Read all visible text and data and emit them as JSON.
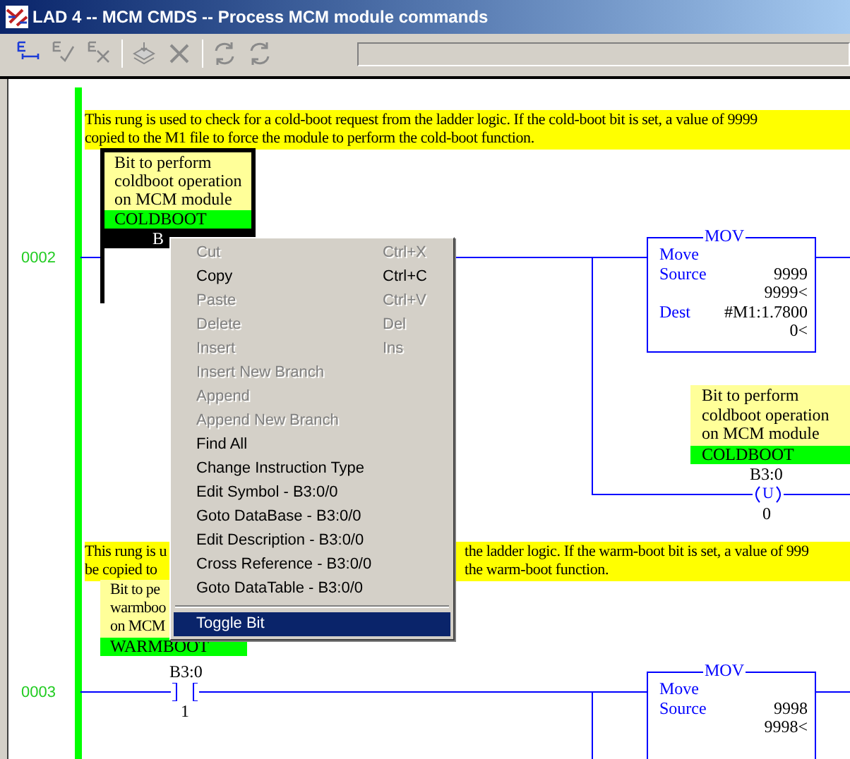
{
  "window": {
    "title": "LAD 4 -- MCM CMDS -- Process MCM module commands"
  },
  "toolbar": {
    "buttons": [
      {
        "kind": "edit",
        "disabled": false
      },
      {
        "kind": "accept",
        "disabled": true
      },
      {
        "kind": "cancel",
        "disabled": true
      },
      {
        "kind": "test",
        "disabled": true
      },
      {
        "kind": "delete",
        "disabled": true
      },
      {
        "kind": "refresh",
        "disabled": true
      },
      {
        "kind": "refresh",
        "disabled": true
      }
    ]
  },
  "rungs": [
    {
      "number": "0002",
      "comment": [
        {
          "segments": [
            "This rung is used to check for a cold-boot request from the ladder logic.  If the cold-boot bit is set, a value of 9999"
          ]
        },
        {
          "segments": [
            "copied to the M1 file to force the module to perform the cold-boot function."
          ]
        }
      ],
      "contact": {
        "description": [
          "Bit to perform",
          "coldboot operation",
          "on MCM module"
        ],
        "symbol": "COLDBOOT",
        "address": "B",
        "selected": true
      },
      "mov": {
        "title": "MOV",
        "name": "Move",
        "source_label": "Source",
        "source": "9999",
        "source_value": "9999<",
        "dest_label": "Dest",
        "dest": "#M1:1.7800",
        "dest_value": "0<"
      },
      "coil": {
        "description": [
          "Bit to perform",
          "coldboot operation",
          "on MCM module"
        ],
        "symbol": "COLDBOOT",
        "address": "B3:0",
        "type": "U",
        "value": "0"
      }
    },
    {
      "number": "0003",
      "comment": [
        {
          "segments": [
            "This rung is u",
            "the ladder logic.  If the warm-boot bit is set, a value of 999"
          ]
        },
        {
          "segments": [
            "be copied to",
            "the warm-boot function."
          ]
        }
      ],
      "contact": {
        "description": [
          "Bit to pe",
          "warmboo",
          "on MCM"
        ],
        "symbol": "WARMBOOT",
        "address": "B3:0",
        "value": "1",
        "selected": false
      },
      "mov": {
        "title": "MOV",
        "name": "Move",
        "source_label": "Source",
        "source": "9998",
        "source_value": "9998<"
      }
    }
  ],
  "context_menu": [
    {
      "label": "Cut",
      "shortcut": "Ctrl+X",
      "disabled": true,
      "selected": false
    },
    {
      "label": "Copy",
      "shortcut": "Ctrl+C",
      "disabled": false,
      "selected": false
    },
    {
      "label": "Paste",
      "shortcut": "Ctrl+V",
      "disabled": true,
      "selected": false
    },
    {
      "label": "Delete",
      "shortcut": "Del",
      "disabled": true,
      "selected": false
    },
    {
      "label": "Insert",
      "shortcut": "Ins",
      "disabled": true,
      "selected": false
    },
    {
      "label": "Insert New Branch",
      "disabled": true,
      "selected": false
    },
    {
      "label": "Append",
      "disabled": true,
      "selected": false
    },
    {
      "label": "Append New Branch",
      "disabled": true,
      "selected": false
    },
    {
      "label": "Find All",
      "disabled": false,
      "selected": false
    },
    {
      "label": "Change Instruction Type",
      "disabled": false,
      "selected": false
    },
    {
      "label": "Edit Symbol - B3:0/0",
      "disabled": false,
      "selected": false
    },
    {
      "label": "Goto DataBase - B3:0/0",
      "disabled": false,
      "selected": false
    },
    {
      "label": "Edit Description - B3:0/0",
      "disabled": false,
      "selected": false
    },
    {
      "label": "Cross Reference - B3:0/0",
      "disabled": false,
      "selected": false
    },
    {
      "label": "Goto DataTable - B3:0/0",
      "disabled": false,
      "selected": false
    },
    {
      "kind": "separator"
    },
    {
      "label": "Toggle Bit",
      "disabled": false,
      "selected": true
    }
  ]
}
